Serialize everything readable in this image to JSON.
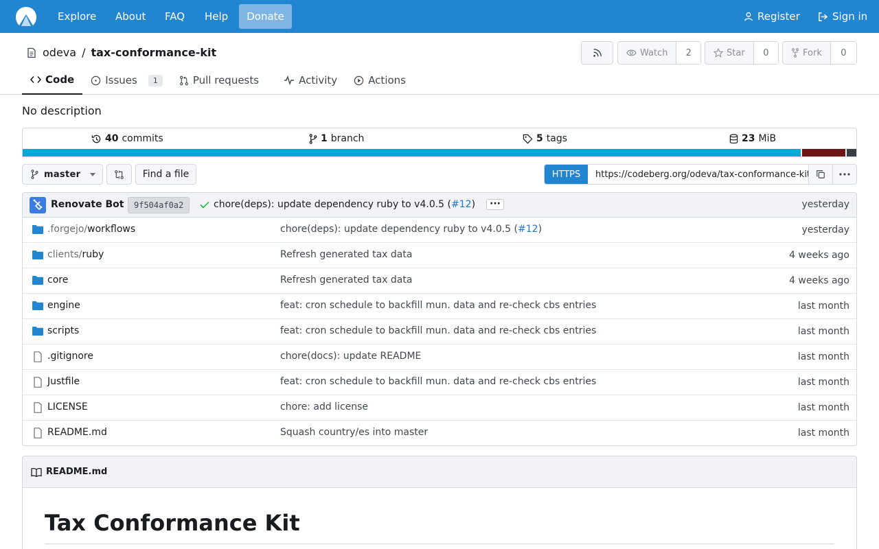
{
  "nav": {
    "links": [
      "Explore",
      "About",
      "FAQ",
      "Help"
    ],
    "donate": "Donate",
    "register": "Register",
    "sign_in": "Sign in"
  },
  "repo": {
    "owner": "odeva",
    "separator": "/",
    "name": "tax-conformance-kit",
    "watch_label": "Watch",
    "watch_count": "2",
    "star_label": "Star",
    "star_count": "0",
    "fork_label": "Fork",
    "fork_count": "0"
  },
  "tabs": {
    "code": "Code",
    "issues": "Issues",
    "issues_count": "1",
    "pulls": "Pull requests",
    "activity": "Activity",
    "actions": "Actions"
  },
  "description": "No description",
  "stats": {
    "commits_num": "40",
    "commits_label": "commits",
    "branch_num": "1",
    "branch_label": "branch",
    "tags_num": "5",
    "tags_label": "tags",
    "size_num": "23",
    "size_label": "MiB"
  },
  "languages": [
    {
      "color": "#00aad4",
      "fraction": 0.935
    },
    {
      "color": "#701516",
      "fraction": 0.052
    },
    {
      "color": "#3a3f44",
      "fraction": 0.013
    }
  ],
  "toolbar": {
    "branch": "master",
    "find_file": "Find a file",
    "clone_protocol": "HTTPS",
    "clone_url": "https://codeberg.org/odeva/tax-conformance-kit.git"
  },
  "latest_commit": {
    "author": "Renovate Bot",
    "sha": "9f504af0a2",
    "message": "chore(deps): update dependency ruby to v4.0.5 (",
    "pr": "#12",
    "message_end": ")",
    "time": "yesterday"
  },
  "files": [
    {
      "type": "dir",
      "prefix": ".forgejo/",
      "name": "workflows",
      "message": "chore(deps): update dependency ruby to v4.0.5 (",
      "pr": "#12",
      "message_end": ")",
      "time": "yesterday"
    },
    {
      "type": "dir",
      "prefix": "clients/",
      "name": "ruby",
      "message": "Refresh generated tax data",
      "pr": "",
      "message_end": "",
      "time": "4 weeks ago"
    },
    {
      "type": "dir",
      "prefix": "",
      "name": "core",
      "message": "Refresh generated tax data",
      "pr": "",
      "message_end": "",
      "time": "4 weeks ago"
    },
    {
      "type": "dir",
      "prefix": "",
      "name": "engine",
      "message": "feat: cron schedule to backfill mun. data and re-check cbs entries",
      "pr": "",
      "message_end": "",
      "time": "last month"
    },
    {
      "type": "dir",
      "prefix": "",
      "name": "scripts",
      "message": "feat: cron schedule to backfill mun. data and re-check cbs entries",
      "pr": "",
      "message_end": "",
      "time": "last month"
    },
    {
      "type": "file",
      "prefix": "",
      "name": ".gitignore",
      "message": "chore(docs): update README",
      "pr": "",
      "message_end": "",
      "time": "last month"
    },
    {
      "type": "file",
      "prefix": "",
      "name": "Justfile",
      "message": "feat: cron schedule to backfill mun. data and re-check cbs entries",
      "pr": "",
      "message_end": "",
      "time": "last month"
    },
    {
      "type": "file",
      "prefix": "",
      "name": "LICENSE",
      "message": "chore: add license",
      "pr": "",
      "message_end": "",
      "time": "last month"
    },
    {
      "type": "file",
      "prefix": "",
      "name": "README.md",
      "message": "Squash country/es into master",
      "pr": "",
      "message_end": "",
      "time": "last month"
    }
  ],
  "readme": {
    "filename": "README.md",
    "heading": "Tax Conformance Kit"
  },
  "colors": {
    "nav": "#2185d0",
    "link": "#2176c5",
    "folder": "#2185d0"
  }
}
